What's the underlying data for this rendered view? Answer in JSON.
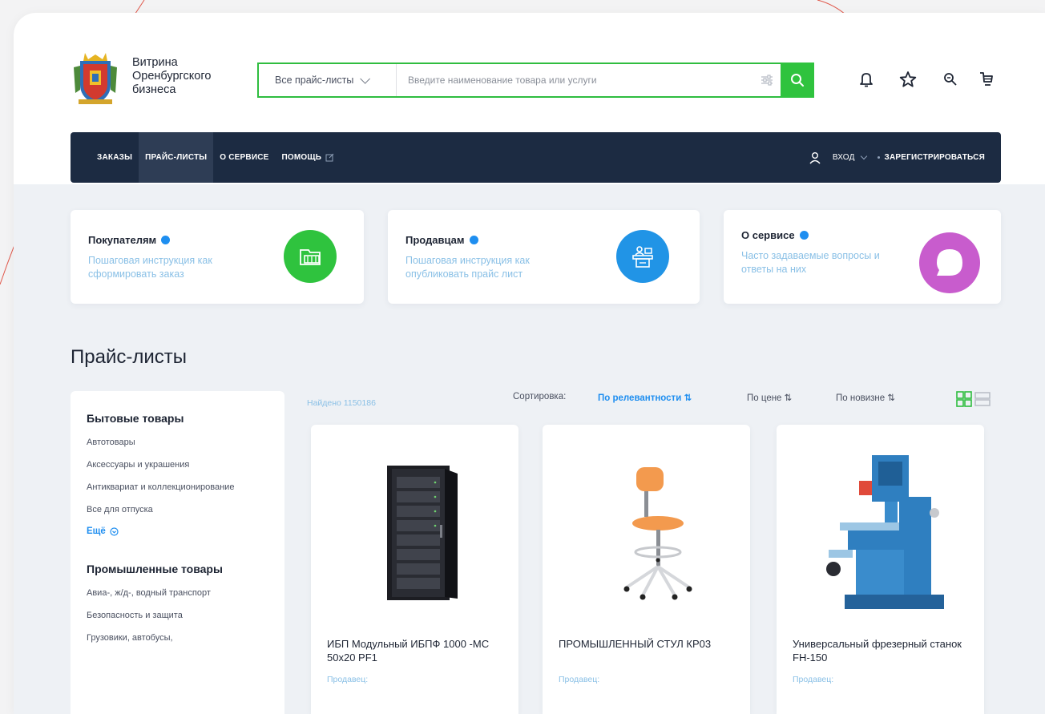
{
  "brand": {
    "line1": "Витрина",
    "line2": "Оренбургского",
    "line3": "бизнеса"
  },
  "search": {
    "category": "Все прайс-листы",
    "placeholder": "Введите наименование товара или услуги"
  },
  "header_icons": [
    "bell-icon",
    "star-icon",
    "compare-icon",
    "cart-icon"
  ],
  "nav": {
    "items": [
      {
        "label": "ЗАКАЗЫ",
        "active": false
      },
      {
        "label": "ПРАЙС-ЛИСТЫ",
        "active": true
      },
      {
        "label": "О СЕРВИСЕ",
        "active": false
      },
      {
        "label": "ПОМОЩЬ",
        "active": false
      }
    ],
    "login": "ВХОД",
    "register": "ЗАРЕГИСТРИРОВАТЬСЯ"
  },
  "info_cards": [
    {
      "title": "Покупателям",
      "subtitle": "Пошаговая инструкция как сформировать заказ",
      "color": "#2fc33e",
      "icon": "basket-icon"
    },
    {
      "title": "Продавцам",
      "subtitle": "Пошаговая инструкция как опубликовать прайс лист",
      "color": "#2194e6",
      "icon": "seller-desk-icon"
    },
    {
      "title": "О сервисе",
      "subtitle": "Часто задаваемые вопросы и ответы на них",
      "color": "#c85ccd",
      "icon": "chat-bubble-icon"
    }
  ],
  "section_title": "Прайс-листы",
  "sidebar": {
    "groups": [
      {
        "title": "Бытовые товары",
        "items": [
          "Автотовары",
          "Аксессуары и украшения",
          "Антиквариат и коллекционирование",
          "Все для отпуска"
        ],
        "more": "Ещё"
      },
      {
        "title": "Промышленные товары",
        "items": [
          "Авиа-, ж/д-, водный транспорт",
          "Безопасность и защита",
          "Грузовики, автобусы,"
        ]
      }
    ]
  },
  "results": {
    "found": "Найдено 1150186",
    "sort_label": "Сортировка:",
    "sort_options": [
      {
        "label": "По релевантности",
        "active": true
      },
      {
        "label": "По цене",
        "active": false
      },
      {
        "label": "По новизне",
        "active": false
      }
    ],
    "view_modes": [
      "grid-view-icon",
      "list-view-icon"
    ]
  },
  "products": [
    {
      "name": "ИБП Модульный ИБПФ 1000 -МС 50х20 PF1",
      "seller": "Продавец:",
      "image": "ups-cabinet-image"
    },
    {
      "name": "ПРОМЫШЛЕННЫЙ СТУЛ КР03",
      "seller": "Продавец:",
      "image": "industrial-chair-image"
    },
    {
      "name": "Универсальный фрезерный станок FH-150",
      "seller": "Продавец:",
      "image": "milling-machine-image"
    }
  ],
  "colors": {
    "accent_green": "#2fc33e",
    "navbar": "#1c2b42",
    "link_blue": "#1e8ef0",
    "muted_blue": "#8ac0e6",
    "decor_red": "#e0574a"
  }
}
